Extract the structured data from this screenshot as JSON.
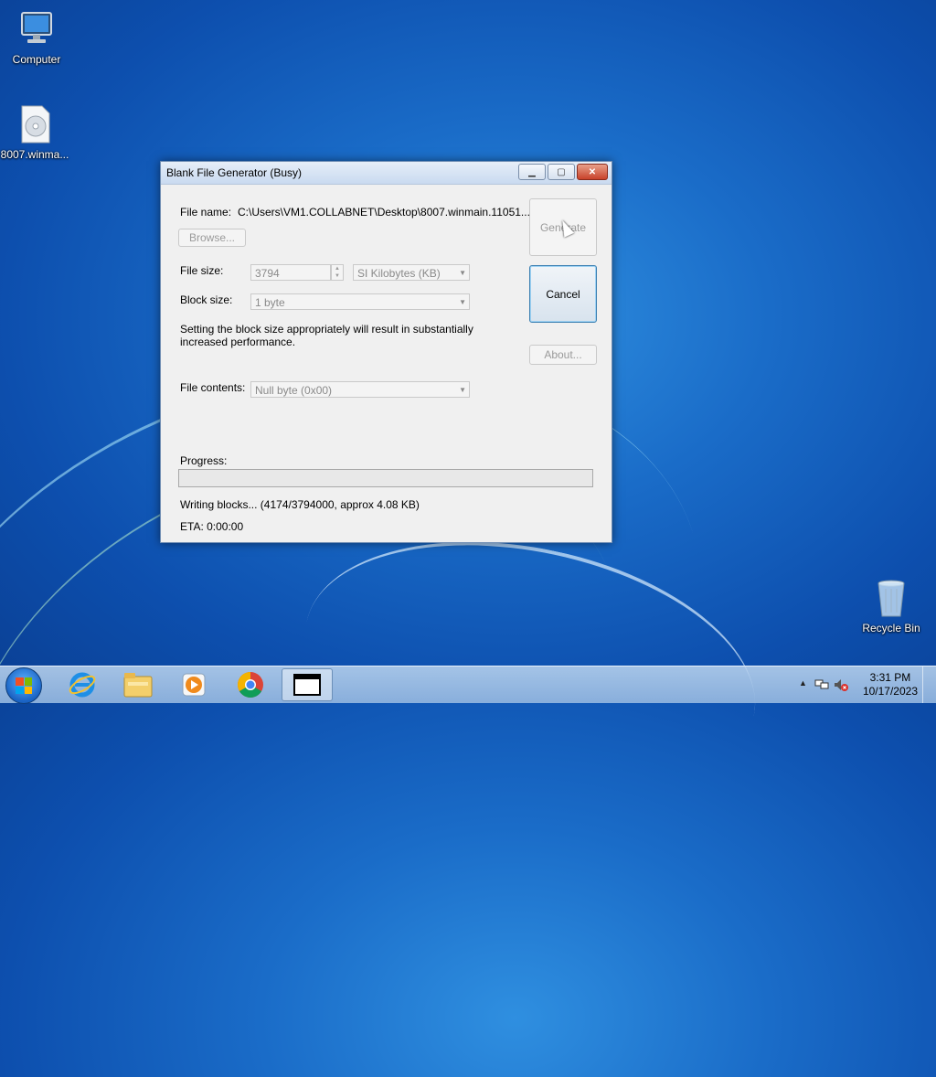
{
  "desktop": {
    "icons": [
      {
        "label": "Computer",
        "icon": "computer-icon"
      },
      {
        "label": "8007.winma...",
        "icon": "disc-image-file-icon"
      },
      {
        "label": "Recycle Bin",
        "icon": "recycle-bin-icon"
      }
    ]
  },
  "window": {
    "title": "Blank File Generator (Busy)",
    "file_name_label": "File name:",
    "file_name_value": "C:\\Users\\VM1.COLLABNET\\Desktop\\8007.winmain.11051...",
    "browse_label": "Browse...",
    "file_size_label": "File size:",
    "file_size_value": "3794",
    "size_unit_value": "SI Kilobytes (KB)",
    "block_size_label": "Block size:",
    "block_size_value": "1 byte",
    "hint_text": "Setting the block size appropriately will result in substantially increased performance.",
    "file_contents_label": "File contents:",
    "file_contents_value": "Null byte (0x00)",
    "generate_label": "Generate",
    "cancel_label": "Cancel",
    "about_label": "About...",
    "progress_label": "Progress:",
    "progress_fraction": 0.0011,
    "status_text": "Writing blocks... (4174/3794000, approx 4.08 KB)",
    "eta_text": "ETA: 0:00:00"
  },
  "taskbar": {
    "items": [
      "internet-explorer-icon",
      "file-explorer-icon",
      "media-player-icon",
      "chrome-icon",
      "app-window-icon"
    ],
    "clock_time": "3:31 PM",
    "clock_date": "10/17/2023"
  }
}
